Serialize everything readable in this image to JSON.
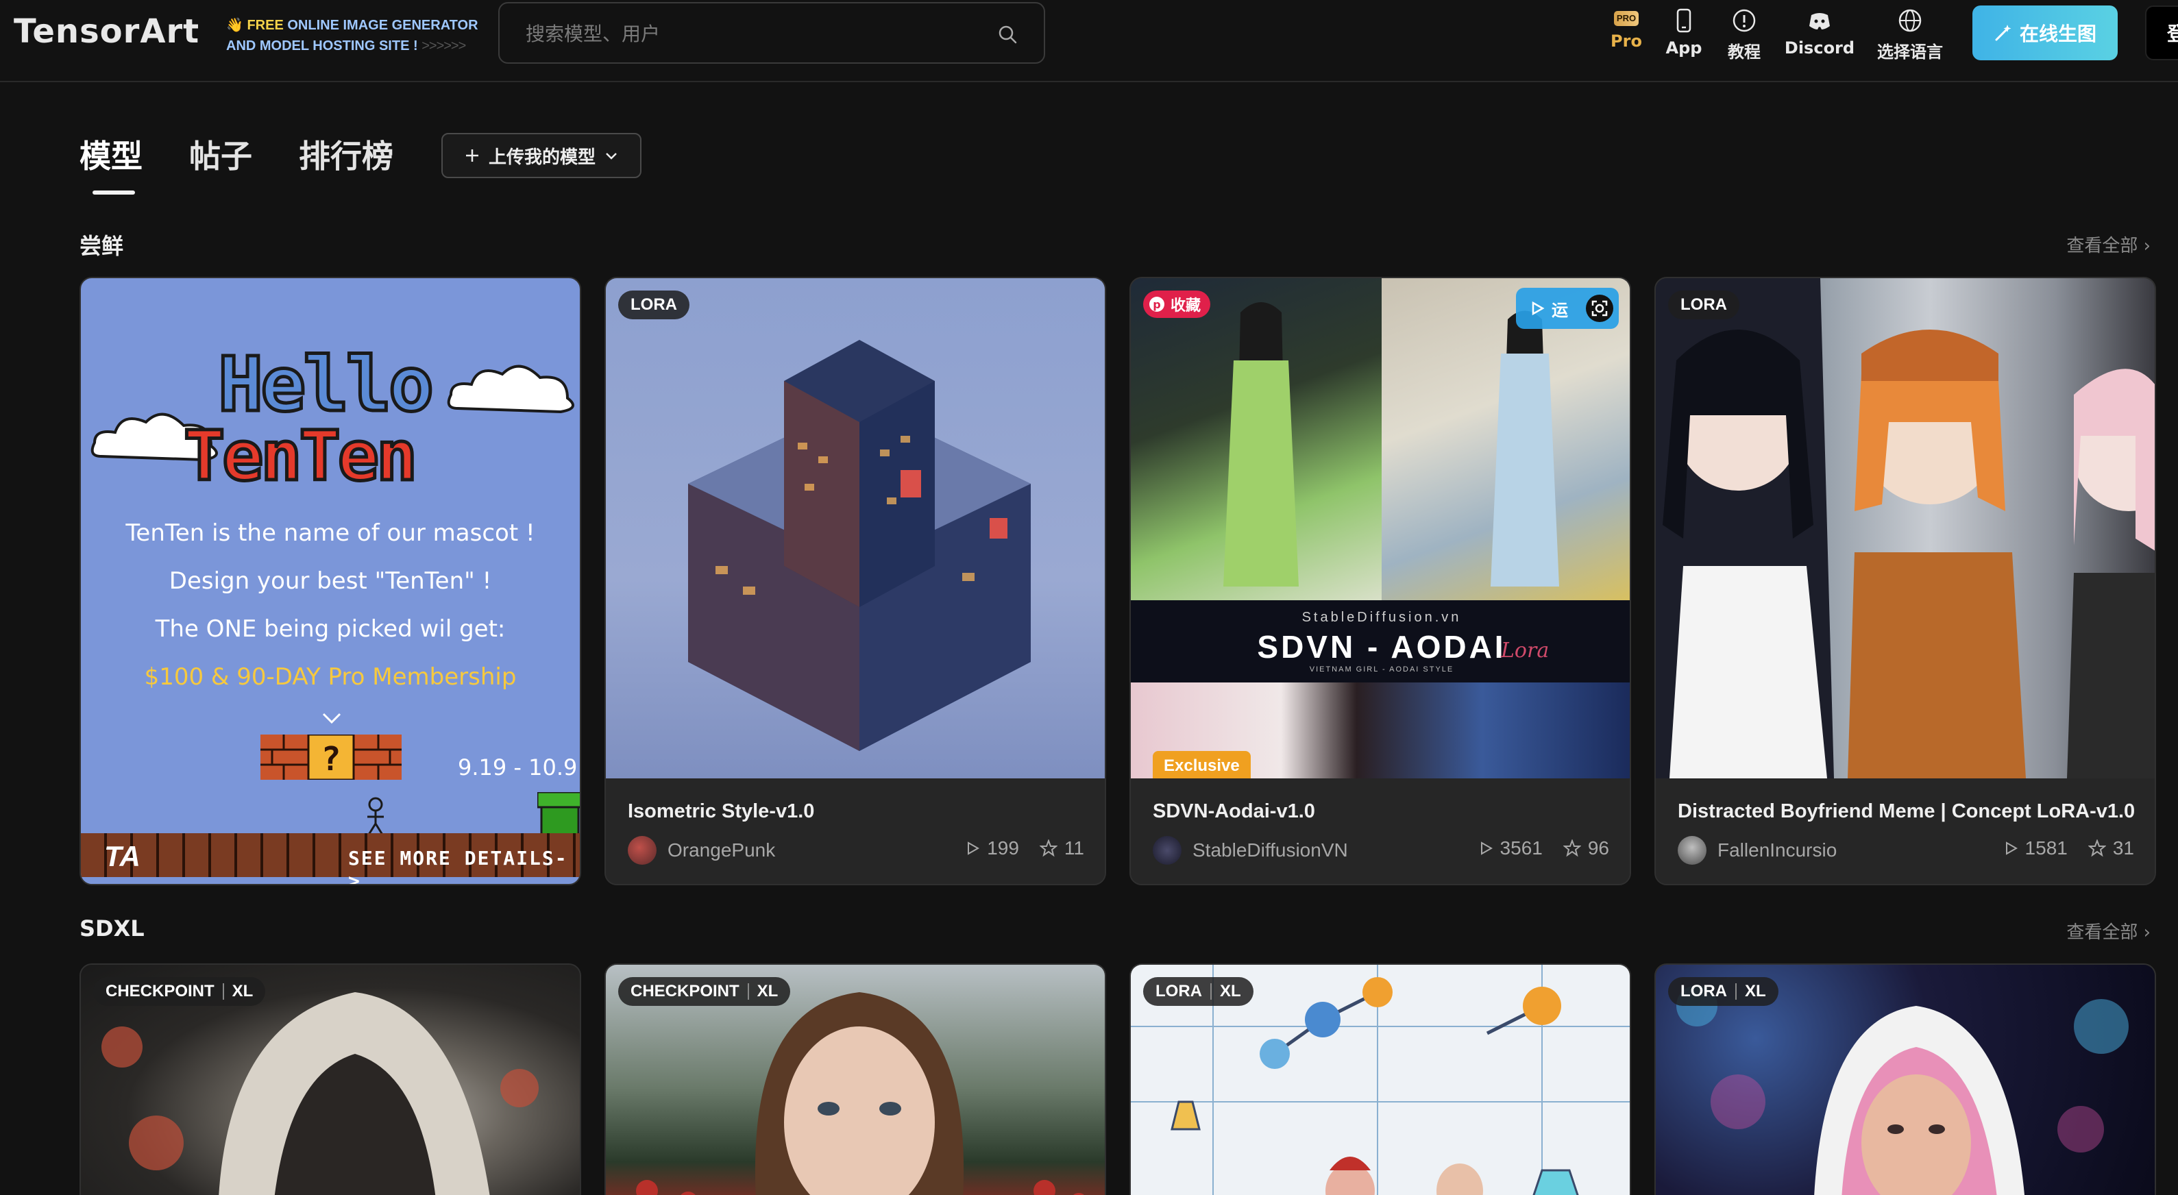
{
  "header": {
    "logo": "TensorArt",
    "tagline_prefix": "FREE",
    "tagline_line1": " ONLINE IMAGE GENERATOR",
    "tagline_line2": "AND MODEL HOSTING SITE !",
    "tagline_arrows": ">>>>>>",
    "search_placeholder": "搜索模型、用户",
    "nav": [
      {
        "label": "Pro",
        "icon": "pro-badge-icon"
      },
      {
        "label": "App",
        "icon": "phone-icon"
      },
      {
        "label": "教程",
        "icon": "info-circle-icon"
      },
      {
        "label": "Discord",
        "icon": "discord-icon"
      },
      {
        "label": "选择语言",
        "icon": "globe-icon"
      }
    ],
    "pro_badge_text": "PRO",
    "generate_button": "在线生图",
    "login_button": "登"
  },
  "tabs": [
    {
      "label": "模型",
      "active": true
    },
    {
      "label": "帖子",
      "active": false
    },
    {
      "label": "排行榜",
      "active": false
    }
  ],
  "upload_button": "上传我的模型",
  "sections": [
    {
      "title": "尝鲜",
      "view_all": "查看全部",
      "cards": [
        {
          "type": "promo",
          "promo": {
            "hello": "Hello",
            "tenten": "TenTen",
            "line1": "TenTen is the name of our mascot !",
            "line2": "Design your best \"TenTen\" !",
            "line3": "The ONE being picked wil get:",
            "line4": "$100 & 90-DAY Pro Membership",
            "date": "9.19 - 10.9",
            "logo": "TA",
            "see_more": "SEE MORE DETAILS->"
          }
        },
        {
          "badge": [
            "LORA"
          ],
          "title": "Isometric Style-v1.0",
          "author": "OrangePunk",
          "runs": "199",
          "stars": "11"
        },
        {
          "fav_badge": "收藏",
          "run_badge": "运",
          "image_text_small": "StableDiffusion.vn",
          "image_text_big": "SDVN - AODAI",
          "image_text_sub": "VIETNAM GIRL - AODAI STYLE",
          "image_text_script": "Lora",
          "exclusive": "Exclusive",
          "title": "SDVN-Aodai-v1.0",
          "author": "StableDiffusionVN",
          "runs": "3561",
          "stars": "96"
        },
        {
          "badge": [
            "LORA"
          ],
          "title": "Distracted Boyfriend Meme | Concept LoRA-v1.0",
          "author": "FallenIncursio",
          "runs": "1581",
          "stars": "31"
        }
      ]
    },
    {
      "title": "SDXL",
      "view_all": "查看全部",
      "cards": [
        {
          "badge": [
            "CHECKPOINT",
            "XL"
          ]
        },
        {
          "badge": [
            "CHECKPOINT",
            "XL"
          ]
        },
        {
          "badge": [
            "LORA",
            "XL"
          ]
        },
        {
          "badge": [
            "LORA",
            "XL"
          ]
        }
      ]
    }
  ],
  "colors": {
    "background": "#121212",
    "card": "#262626",
    "accent_gradient_start": "#3fb3e6",
    "pro_gold": "#e8b24a",
    "exclusive_orange": "#f0a020",
    "favorite_red": "#e0204a"
  }
}
